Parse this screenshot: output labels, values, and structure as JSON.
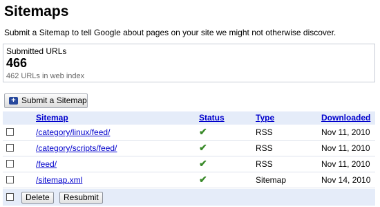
{
  "page": {
    "title": "Sitemaps",
    "description": "Submit a Sitemap to tell Google about pages on your site we might not otherwise discover."
  },
  "stats": {
    "label": "Submitted URLs",
    "count": "466",
    "indexed": "462 URLs in web index"
  },
  "toolbar": {
    "submit_label": "Submit a Sitemap",
    "submit_icon": "plus-icon"
  },
  "table": {
    "headers": {
      "sitemap": "Sitemap",
      "status": "Status",
      "type": "Type",
      "downloaded": "Downloaded"
    },
    "rows": [
      {
        "url": "/category/linux/feed/",
        "status": "ok",
        "type": "RSS",
        "downloaded": "Nov 11, 2010"
      },
      {
        "url": "/category/scripts/feed/",
        "status": "ok",
        "type": "RSS",
        "downloaded": "Nov 11, 2010"
      },
      {
        "url": "/feed/",
        "status": "ok",
        "type": "RSS",
        "downloaded": "Nov 11, 2010"
      },
      {
        "url": "/sitemap.xml",
        "status": "ok",
        "type": "Sitemap",
        "downloaded": "Nov 14, 2010"
      }
    ]
  },
  "footer": {
    "delete_label": "Delete",
    "resubmit_label": "Resubmit"
  },
  "colors": {
    "link": "#0000cc",
    "header_bg": "#e5ecf9",
    "check": "#3a8a2a"
  }
}
